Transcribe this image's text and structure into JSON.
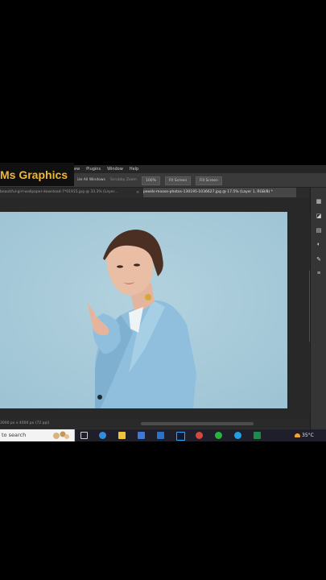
{
  "overlay": {
    "channel_logo": "Ms Graphics"
  },
  "menubar": {
    "items": [
      "ew",
      "Plugins",
      "Window",
      "Help"
    ]
  },
  "options_bar": {
    "buttons": [
      "ize All Windows",
      "Scrubby Zoom",
      "100%",
      "Fit Screen",
      "Fill Screen"
    ]
  },
  "tabs": {
    "inactive_label": "beautiful-girl-wallpaper-download-7*01915.jpg @ 33.3% (Layer...",
    "close_glyph": "×",
    "active_label": "pexels-moose-photos-130195-1036627.jpg @ 17.5% (Layer 1, RGB/8) *"
  },
  "status_bar": {
    "doc_info": "3000 px x 4000 px (72 ppi)"
  },
  "taskbar": {
    "search_placeholder": "to search",
    "weather": "35°C",
    "icons": [
      "task-view-icon",
      "edge-icon",
      "file-explorer-icon",
      "store-icon",
      "mail-icon",
      "photoshop-icon",
      "chrome-icon",
      "whatsapp-icon",
      "skype-icon",
      "excel-icon"
    ]
  },
  "colors": {
    "logo_gold": "#f2b632",
    "photo_background": "#a8cad9",
    "blazer_blue": "#8fbfdd"
  }
}
